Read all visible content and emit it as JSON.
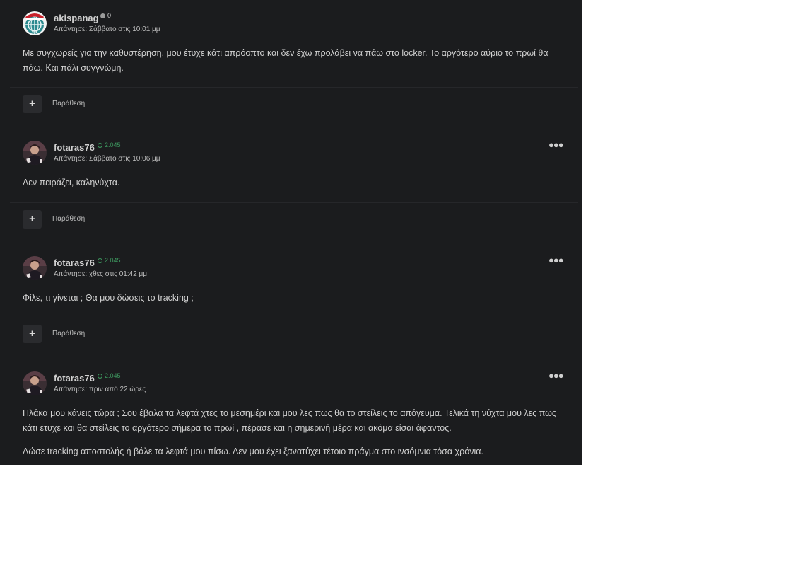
{
  "posts": [
    {
      "author": "akispanag",
      "rep": "0",
      "meta": "Απάντησε: Σάββατο στις 10:01 μμ",
      "paragraphs": [
        "Με συγχωρείς για την καθυστέρηση, μου έτυχε κάτι απρόοπτο και δεν έχω προλάβει να πάω στο locker. Το αργότερο αύριο το πρωί θα πάω. Και πάλι συγγνώμη."
      ],
      "quote_label": "Παράθεση"
    },
    {
      "author": "fotaras76",
      "rep": "2.045",
      "meta": "Απάντησε: Σάββατο στις 10:06 μμ",
      "paragraphs": [
        "Δεν πειράζει, καληνύχτα."
      ],
      "quote_label": "Παράθεση"
    },
    {
      "author": "fotaras76",
      "rep": "2.045",
      "meta": "Απάντησε: χθες στις 01:42 μμ",
      "paragraphs": [
        "Φίλε, τι γίνεται ; Θα μου δώσεις το tracking ;"
      ],
      "quote_label": "Παράθεση"
    },
    {
      "author": "fotaras76",
      "rep": "2.045",
      "meta": "Απάντησε: πριν από 22 ώρες",
      "paragraphs": [
        "Πλάκα μου κάνεις τώρα ; Σου έβαλα τα λεφτά χτες το μεσημέρι και μου λες πως θα το στείλεις το απόγευμα. Τελικά τη νύχτα μου λες πως κάτι έτυχε και θα στείλεις το αργότερο σήμερα το πρωί , πέρασε και η σημερινή μέρα και ακόμα είσαι άφαντος.",
        "Δώσε tracking αποστολής ή βάλε τα λεφτά μου πίσω. Δεν μου έχει ξανατύχει τέτοιο πράγμα στο ινσόμνια τόσα χρόνια."
      ]
    }
  ],
  "colors": {
    "background": "#1b1c1e",
    "text": "#d0d0d0",
    "reputation_positive": "#3e9a60",
    "reputation_neutral": "#9a9a9a"
  },
  "icons": {
    "more": "ellipsis-icon",
    "quote": "plus-icon"
  }
}
